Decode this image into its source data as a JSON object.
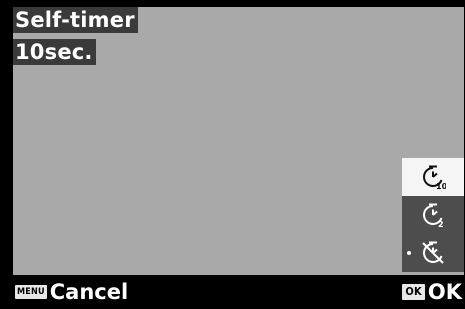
{
  "screen": {
    "title": "Self-timer",
    "value": "10sec."
  },
  "mode_menu": {
    "items": [
      {
        "icon": "self-timer-10sec-icon",
        "selected": true
      },
      {
        "icon": "self-timer-2sec-icon",
        "selected": false
      },
      {
        "icon": "self-timer-off-icon",
        "selected": false,
        "current": true
      }
    ]
  },
  "footer": {
    "cancel_key": "MENU",
    "cancel_label": "Cancel",
    "ok_key": "OK",
    "ok_label": "OK"
  },
  "colors": {
    "viewport": "#a9a9a9",
    "label_background": "#3a3a3a",
    "menu_background": "#4d4d4d",
    "menu_selected": "#f5f5f5"
  }
}
